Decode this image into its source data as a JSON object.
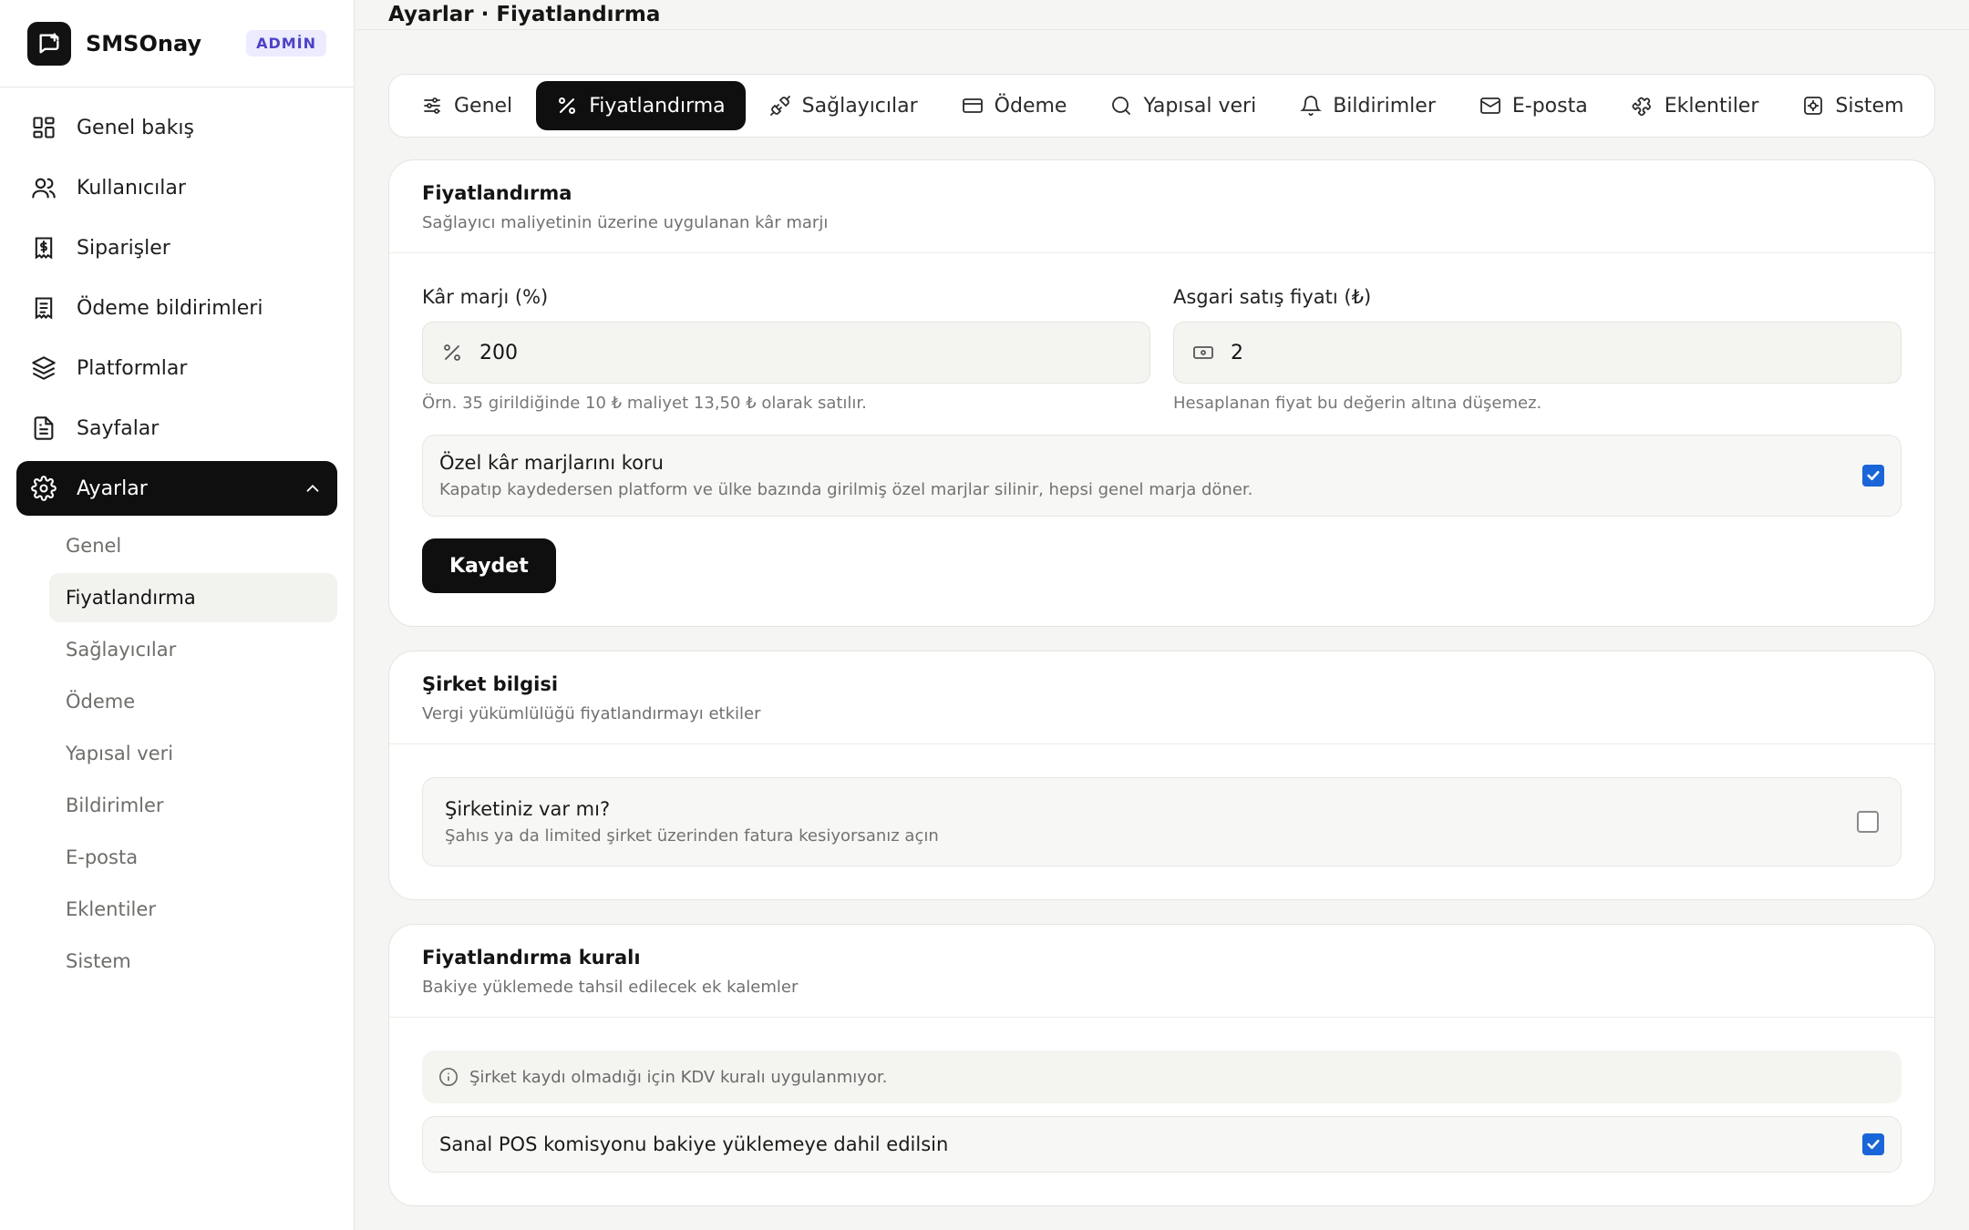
{
  "brand": {
    "name": "SMSOnay",
    "badge": "ADMİN"
  },
  "sidebar": {
    "items": [
      {
        "label": "Genel bakış",
        "icon": "dashboard-icon"
      },
      {
        "label": "Kullanıcılar",
        "icon": "users-icon"
      },
      {
        "label": "Siparişler",
        "icon": "receipt-icon"
      },
      {
        "label": "Ödeme bildirimleri",
        "icon": "document-list-icon"
      },
      {
        "label": "Platformlar",
        "icon": "layers-icon"
      },
      {
        "label": "Sayfalar",
        "icon": "file-text-icon"
      },
      {
        "label": "Ayarlar",
        "icon": "gear-icon"
      }
    ],
    "sub_items": [
      "Genel",
      "Fiyatlandırma",
      "Sağlayıcılar",
      "Ödeme",
      "Yapısal veri",
      "Bildirimler",
      "E-posta",
      "Eklentiler",
      "Sistem"
    ]
  },
  "header": {
    "title": "Ayarlar · Fiyatlandırma"
  },
  "tabs": [
    "Genel",
    "Fiyatlandırma",
    "Sağlayıcılar",
    "Ödeme",
    "Yapısal veri",
    "Bildirimler",
    "E-posta",
    "Eklentiler",
    "Sistem"
  ],
  "pricing": {
    "title": "Fiyatlandırma",
    "subtitle": "Sağlayıcı maliyetinin üzerine uygulanan kâr marjı",
    "margin_label": "Kâr marjı (%)",
    "margin_value": "200",
    "margin_hint": "Örn. 35 girildiğinde 10 ₺ maliyet 13,50 ₺ olarak satılır.",
    "min_label": "Asgari satış fiyatı (₺)",
    "min_value": "2",
    "min_hint": "Hesaplanan fiyat bu değerin altına düşemez.",
    "protect_title": "Özel kâr marjlarını koru",
    "protect_desc": "Kapatıp kaydedersen platform ve ülke bazında girilmiş özel marjlar silinir, hepsi genel marja döner.",
    "save_label": "Kaydet"
  },
  "company": {
    "title": "Şirket bilgisi",
    "subtitle": "Vergi yükümlülüğü fiyatlandırmayı etkiler",
    "toggle_title": "Şirketiniz var mı?",
    "toggle_desc": "Şahıs ya da limited şirket üzerinden fatura kesiyorsanız açın"
  },
  "rules": {
    "title": "Fiyatlandırma kuralı",
    "subtitle": "Bakiye yüklemede tahsil edilecek ek kalemler",
    "info": "Şirket kaydı olmadığı için KDV kuralı uygulanmıyor.",
    "pos_title": "Sanal POS komisyonu bakiye yüklemeye dahil edilsin"
  },
  "colors": {
    "accent": "#0f0f0f",
    "checkbox": "#1a66d8",
    "badge_bg": "#ecebff",
    "badge_text": "#4d43c7"
  }
}
